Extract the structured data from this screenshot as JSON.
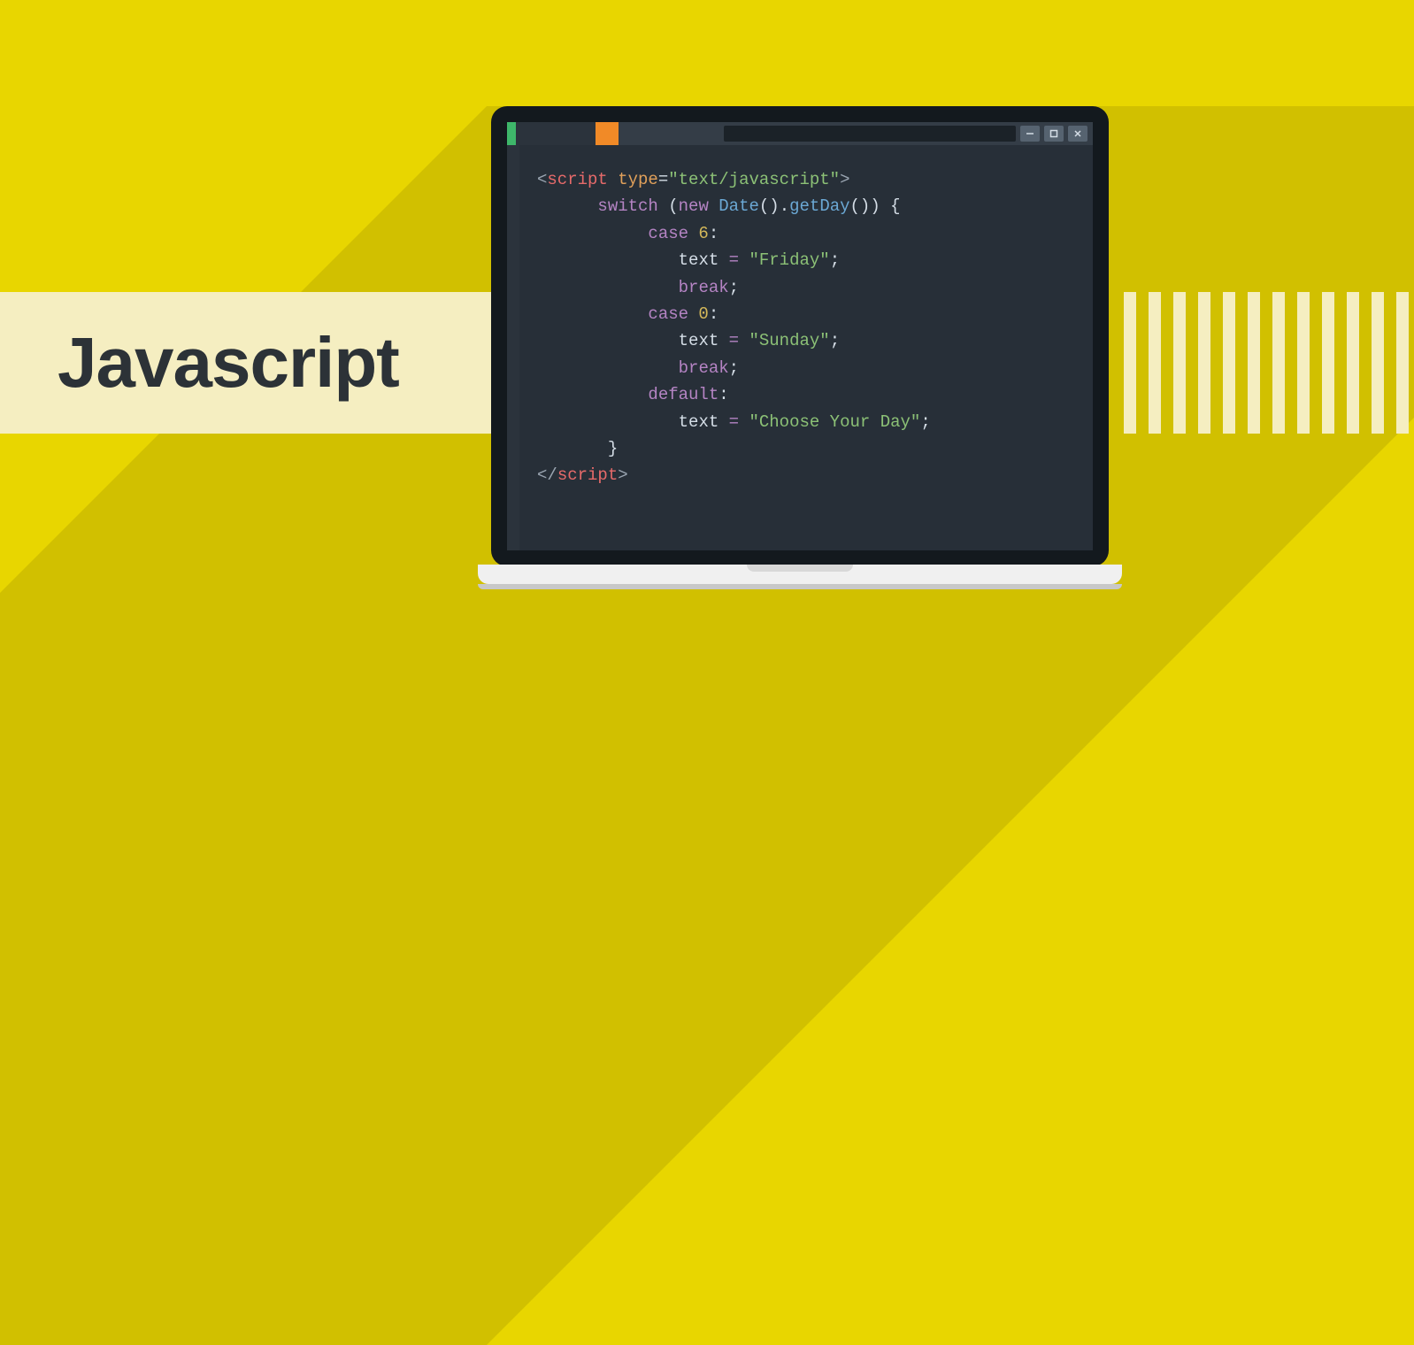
{
  "title": "Javascript",
  "code": {
    "line1_open": "<",
    "line1_tag": "script",
    "line1_attr": " type",
    "line1_eq": "=",
    "line1_str": "\"text/javascript\"",
    "line1_close": ">",
    "line2_switch": "switch",
    "line2_paren1": " (",
    "line2_new": "new",
    "line2_date": " Date",
    "line2_paren2": "().",
    "line2_getday": "getDay",
    "line2_paren3": "()) {",
    "line3_case": "case",
    "line3_num": " 6",
    "line3_colon": ":",
    "line4_text": "text ",
    "line4_eq": "= ",
    "line4_str": "\"Friday\"",
    "line4_semi": ";",
    "line5_break": "break",
    "line5_semi": ";",
    "line6_case": "case",
    "line6_num": " 0",
    "line6_colon": ":",
    "line7_text": "text ",
    "line7_eq": "= ",
    "line7_str": "\"Sunday\"",
    "line7_semi": ";",
    "line8_break": "break",
    "line8_semi": ";",
    "line9_default": "default",
    "line9_colon": ":",
    "line10_text": "text ",
    "line10_eq": "= ",
    "line10_str": "\"Choose Your Day\"",
    "line10_semi": ";",
    "line11_brace": "}",
    "line12_open": "</",
    "line12_tag": "script",
    "line12_close": ">"
  }
}
